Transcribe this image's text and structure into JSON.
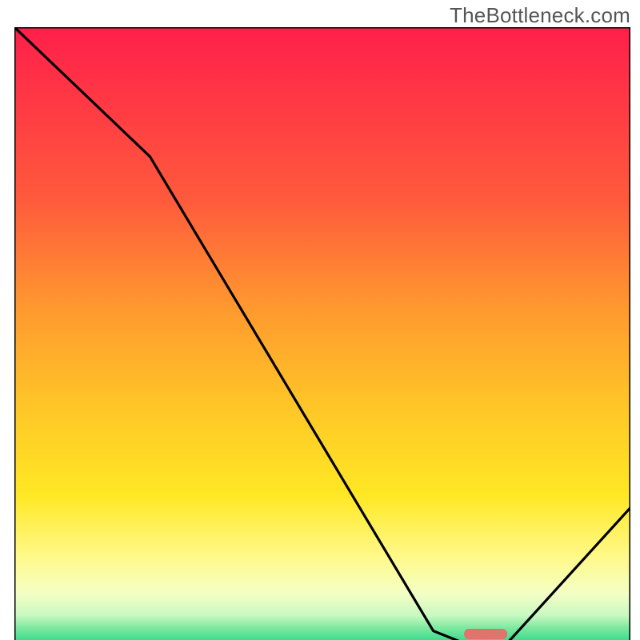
{
  "watermark": "TheBottleneck.com",
  "colors": {
    "gradient": [
      {
        "offset": 0.0,
        "color": "#ff1f4a"
      },
      {
        "offset": 0.28,
        "color": "#ff5a3c"
      },
      {
        "offset": 0.46,
        "color": "#ff9a2e"
      },
      {
        "offset": 0.62,
        "color": "#ffc727"
      },
      {
        "offset": 0.76,
        "color": "#ffe824"
      },
      {
        "offset": 0.86,
        "color": "#fff98a"
      },
      {
        "offset": 0.92,
        "color": "#f4ffc5"
      },
      {
        "offset": 0.955,
        "color": "#c8f9c1"
      },
      {
        "offset": 0.975,
        "color": "#7ee9a0"
      },
      {
        "offset": 1.0,
        "color": "#2ed88a"
      }
    ],
    "curve": "#000000",
    "marker": "#e0736b"
  },
  "chart_data": {
    "type": "line",
    "title": "",
    "xlabel": "",
    "ylabel": "",
    "xlim": [
      0,
      1
    ],
    "ylim": [
      0,
      1
    ],
    "series": [
      {
        "name": "curve",
        "x": [
          0.0,
          0.22,
          0.68,
          0.73,
          0.8,
          1.0
        ],
        "y": [
          1.0,
          0.79,
          0.02,
          0.0,
          0.0,
          0.22
        ]
      }
    ],
    "ideal_range_x": [
      0.73,
      0.8
    ],
    "axis_ticks": {
      "x": [],
      "y": []
    }
  }
}
